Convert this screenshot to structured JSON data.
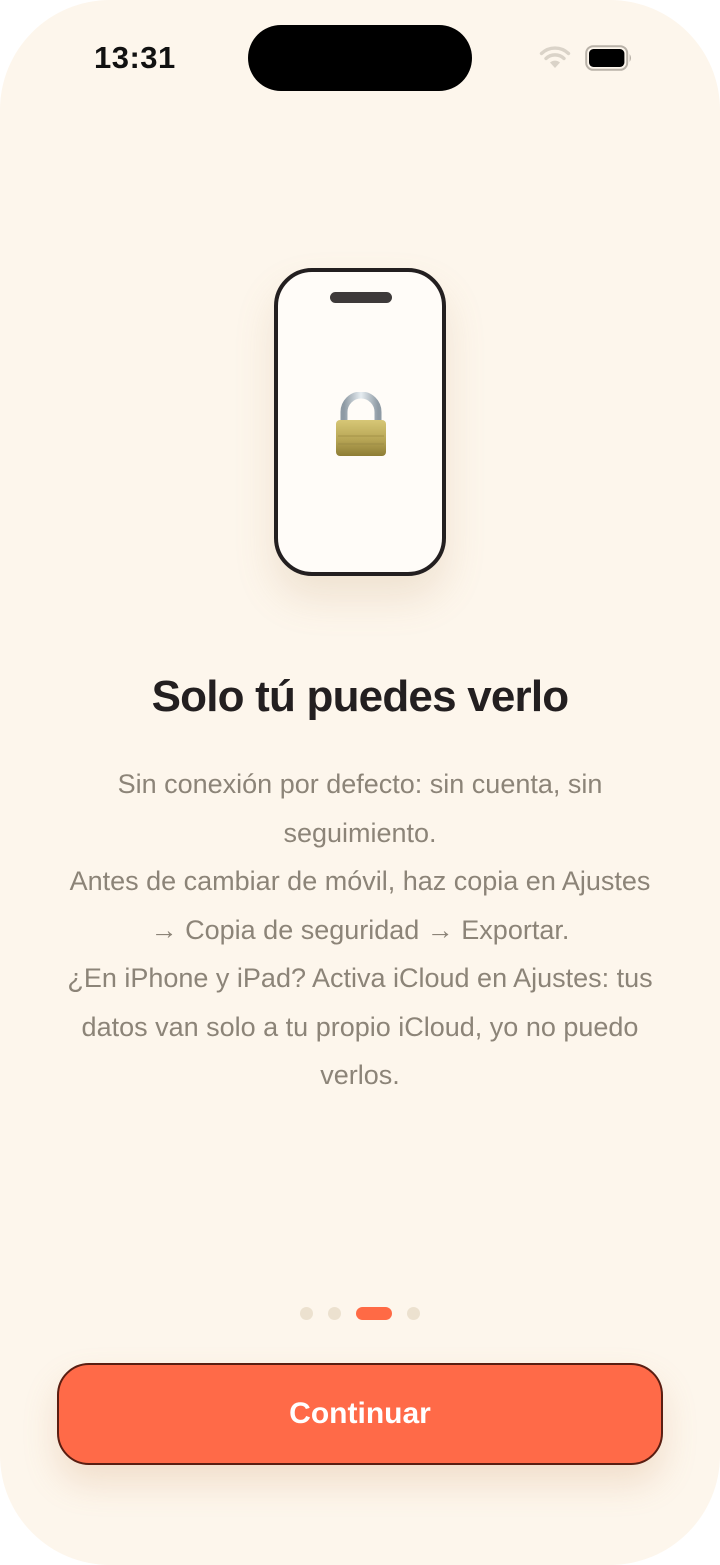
{
  "status_bar": {
    "time": "13:31",
    "icons": [
      "wifi-icon",
      "battery-icon"
    ]
  },
  "illustration": {
    "icon": "lock-icon"
  },
  "onboarding": {
    "title": "Solo tú puedes verlo",
    "body_lines": [
      "Sin conexión por defecto: sin cuenta, sin seguimiento.",
      "Antes de cambiar de móvil, haz copia en Ajustes → Copia de seguridad → Exportar.",
      "¿En iPhone y iPad? Activa iCloud en Ajustes: tus datos van solo a tu propio iCloud, yo no puedo verlos."
    ],
    "pager": {
      "count": 4,
      "current": 3
    },
    "continue_label": "Continuar"
  },
  "colors": {
    "background": "#fdf6ec",
    "accent": "#ff6a48",
    "title": "#231f20",
    "body": "#8c8478"
  }
}
